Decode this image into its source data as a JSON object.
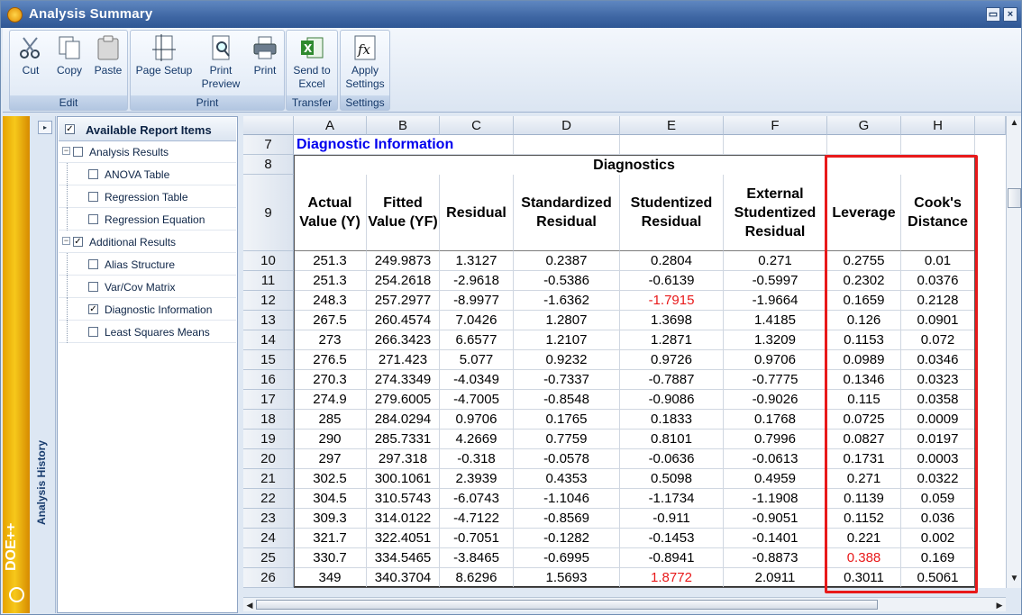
{
  "window": {
    "title": "Analysis Summary"
  },
  "ribbon": {
    "groups": [
      {
        "label": "Edit",
        "buttons": [
          "Cut",
          "Copy",
          "Paste"
        ]
      },
      {
        "label": "Print",
        "buttons": [
          "Page Setup",
          "Print Preview",
          "Print"
        ]
      },
      {
        "label": "Transfer",
        "buttons": [
          "Send to Excel"
        ]
      },
      {
        "label": "Settings",
        "buttons": [
          "Apply Settings"
        ]
      }
    ]
  },
  "sidebar": {
    "history_label": "Analysis History",
    "brand": "DOE++"
  },
  "tree": {
    "header": "Available Report Items",
    "items": [
      {
        "label": "Analysis Results",
        "level": 0,
        "checked": false
      },
      {
        "label": "ANOVA Table",
        "level": 1,
        "checked": false
      },
      {
        "label": "Regression Table",
        "level": 1,
        "checked": false
      },
      {
        "label": "Regression Equation",
        "level": 1,
        "checked": false
      },
      {
        "label": "Additional Results",
        "level": 0,
        "checked": true
      },
      {
        "label": "Alias Structure",
        "level": 1,
        "checked": false
      },
      {
        "label": "Var/Cov Matrix",
        "level": 1,
        "checked": false
      },
      {
        "label": "Diagnostic Information",
        "level": 1,
        "checked": true
      },
      {
        "label": "Least Squares Means",
        "level": 1,
        "checked": false
      }
    ]
  },
  "sheet": {
    "columns": [
      "A",
      "B",
      "C",
      "D",
      "E",
      "F",
      "G",
      "H"
    ],
    "section_title": "Diagnostic Information",
    "group_header": "Diagnostics",
    "headers": [
      "Actual Value (Y)",
      "Fitted Value (YF)",
      "Residual",
      "Standardized Residual",
      "Studentized Residual",
      "External Studentized Residual",
      "Leverage",
      "Cook's Distance"
    ],
    "row_numbers": [
      "7",
      "8",
      "9",
      "10",
      "11",
      "12",
      "13",
      "14",
      "15",
      "16",
      "17",
      "18",
      "19",
      "20",
      "21",
      "22",
      "23",
      "24",
      "25",
      "26"
    ],
    "rows": [
      [
        "251.3",
        "249.9873",
        "1.3127",
        "0.2387",
        "0.2804",
        "0.271",
        "0.2755",
        "0.01"
      ],
      [
        "251.3",
        "254.2618",
        "-2.9618",
        "-0.5386",
        "-0.6139",
        "-0.5997",
        "0.2302",
        "0.0376"
      ],
      [
        "248.3",
        "257.2977",
        "-8.9977",
        "-1.6362",
        "-1.7915",
        "-1.9664",
        "0.1659",
        "0.2128"
      ],
      [
        "267.5",
        "260.4574",
        "7.0426",
        "1.2807",
        "1.3698",
        "1.4185",
        "0.126",
        "0.0901"
      ],
      [
        "273",
        "266.3423",
        "6.6577",
        "1.2107",
        "1.2871",
        "1.3209",
        "0.1153",
        "0.072"
      ],
      [
        "276.5",
        "271.423",
        "5.077",
        "0.9232",
        "0.9726",
        "0.9706",
        "0.0989",
        "0.0346"
      ],
      [
        "270.3",
        "274.3349",
        "-4.0349",
        "-0.7337",
        "-0.7887",
        "-0.7775",
        "0.1346",
        "0.0323"
      ],
      [
        "274.9",
        "279.6005",
        "-4.7005",
        "-0.8548",
        "-0.9086",
        "-0.9026",
        "0.115",
        "0.0358"
      ],
      [
        "285",
        "284.0294",
        "0.9706",
        "0.1765",
        "0.1833",
        "0.1768",
        "0.0725",
        "0.0009"
      ],
      [
        "290",
        "285.7331",
        "4.2669",
        "0.7759",
        "0.8101",
        "0.7996",
        "0.0827",
        "0.0197"
      ],
      [
        "297",
        "297.318",
        "-0.318",
        "-0.0578",
        "-0.0636",
        "-0.0613",
        "0.1731",
        "0.0003"
      ],
      [
        "302.5",
        "300.1061",
        "2.3939",
        "0.4353",
        "0.5098",
        "0.4959",
        "0.271",
        "0.0322"
      ],
      [
        "304.5",
        "310.5743",
        "-6.0743",
        "-1.1046",
        "-1.1734",
        "-1.1908",
        "0.1139",
        "0.059"
      ],
      [
        "309.3",
        "314.0122",
        "-4.7122",
        "-0.8569",
        "-0.911",
        "-0.9051",
        "0.1152",
        "0.036"
      ],
      [
        "321.7",
        "322.4051",
        "-0.7051",
        "-0.1282",
        "-0.1453",
        "-0.1401",
        "0.221",
        "0.002"
      ],
      [
        "330.7",
        "334.5465",
        "-3.8465",
        "-0.6995",
        "-0.8941",
        "-0.8873",
        "0.388",
        "0.169"
      ],
      [
        "349",
        "340.3704",
        "8.6296",
        "1.5693",
        "1.8772",
        "2.0911",
        "0.3011",
        "0.5061"
      ]
    ],
    "flagged_cells": [
      [
        2,
        4
      ],
      [
        15,
        6
      ],
      [
        16,
        4
      ]
    ],
    "colors": {
      "section_title": "#0000ee",
      "flag": "#e8191a",
      "highlight_box": "#e8191a"
    }
  }
}
